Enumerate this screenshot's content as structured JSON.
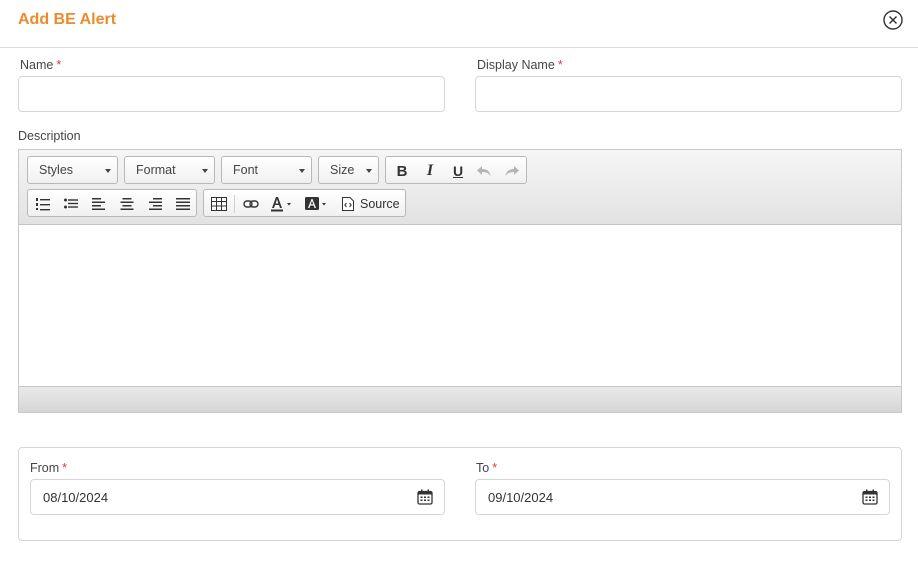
{
  "dialog": {
    "title": "Add BE Alert"
  },
  "form": {
    "name_label": "Name",
    "name_value": "",
    "display_name_label": "Display Name",
    "display_name_value": "",
    "required_marker": "*",
    "description_label": "Description"
  },
  "editor": {
    "styles_label": "Styles",
    "format_label": "Format",
    "font_label": "Font",
    "size_label": "Size",
    "bold_label": "B",
    "italic_label": "I",
    "underline_label": "U",
    "source_label": "Source",
    "content": ""
  },
  "dates": {
    "from_label": "From",
    "from_value": "08/10/2024",
    "to_label": "To",
    "to_value": "09/10/2024"
  },
  "colors": {
    "title": "#ec8a2e",
    "required": "#e03a3a"
  }
}
